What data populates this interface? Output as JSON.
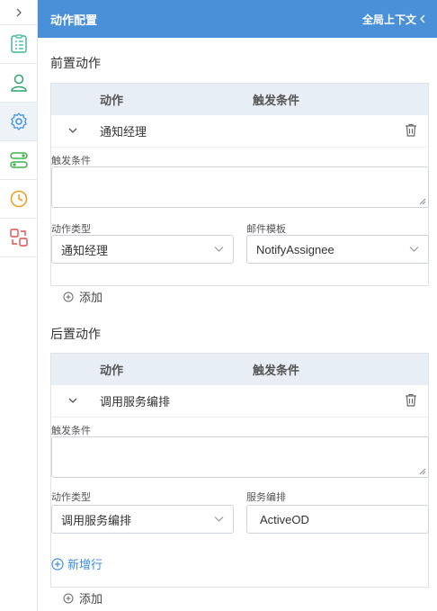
{
  "header": {
    "title": "动作配置",
    "context_label": "全局上下文"
  },
  "sidebar": {
    "items": [
      {
        "icon": "checklist-icon",
        "color": "#3bb59a"
      },
      {
        "icon": "user-icon",
        "color": "#2ea36f"
      },
      {
        "icon": "gear-icon",
        "color": "#3a8ee6",
        "active": true
      },
      {
        "icon": "toggle-icon",
        "color": "#41b34a"
      },
      {
        "icon": "clock-icon",
        "color": "#f0a020"
      },
      {
        "icon": "exchange-icon",
        "color": "#e05050"
      }
    ]
  },
  "pre_actions": {
    "section_title": "前置动作",
    "col_action": "动作",
    "col_trigger": "触发条件",
    "row_name": "通知经理",
    "trigger_label": "触发条件",
    "trigger_value": "",
    "type_label": "动作类型",
    "type_value": "通知经理",
    "template_label": "邮件模板",
    "template_value": "NotifyAssignee",
    "add_label": "添加"
  },
  "post_actions": {
    "section_title": "后置动作",
    "col_action": "动作",
    "col_trigger": "触发条件",
    "row_name": "调用服务编排",
    "trigger_label": "触发条件",
    "trigger_value": "",
    "type_label": "动作类型",
    "type_value": "调用服务编排",
    "service_label": "服务编排",
    "service_value": "ActiveOD",
    "new_row_label": "新增行",
    "add_label": "添加"
  },
  "colors": {
    "header": "#4a90d9",
    "accent": "#3a8ee6",
    "table_head": "#e8eef5"
  }
}
